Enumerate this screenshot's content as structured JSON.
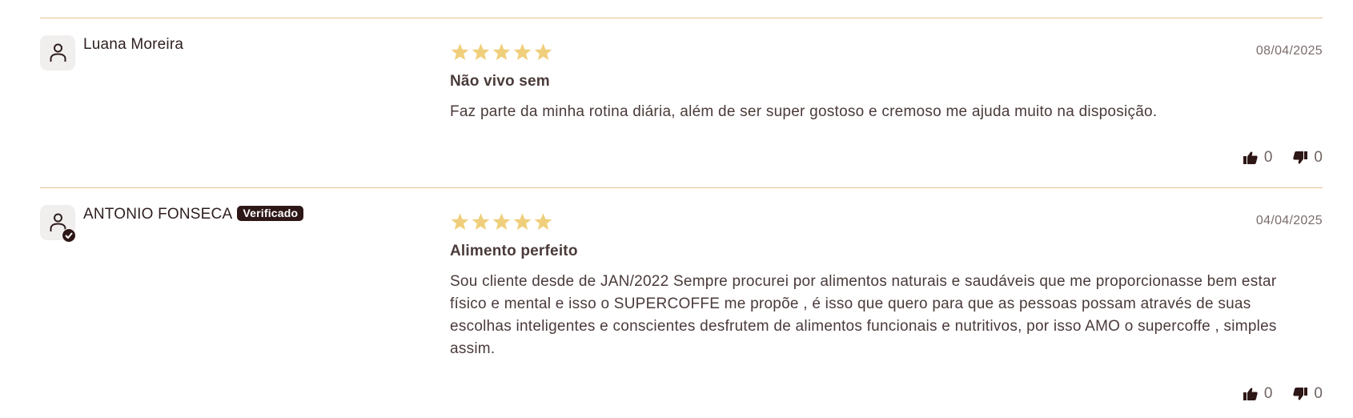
{
  "colors": {
    "divider": "#e8c08e",
    "star": "#f0cf7c",
    "badge_bg": "#2e1717",
    "text": "#4a3b3a",
    "muted": "#7a6d6b"
  },
  "reviews": [
    {
      "author": "Luana Moreira",
      "verified": false,
      "rating": 5,
      "date": "08/04/2025",
      "title": "Não vivo sem",
      "body": "Faz parte da minha rotina diária, além de ser super gostoso e cremoso me ajuda muito na disposição.",
      "likes": "0",
      "dislikes": "0",
      "avatar_icon": "user-icon",
      "like_icon": "thumbs-up-icon",
      "dislike_icon": "thumbs-down-icon"
    },
    {
      "author": "ANTONIO FONSECA",
      "verified": true,
      "badge_label": "Verificado",
      "rating": 5,
      "date": "04/04/2025",
      "title": "Alimento perfeito",
      "body": "Sou cliente desde de JAN/2022 Sempre procurei por alimentos naturais e saudáveis que me proporcionasse bem estar físico e mental e isso o SUPERCOFFE me propõe , é isso que quero para que as pessoas possam através de suas escolhas inteligentes e conscientes desfrutem de alimentos funcionais e nutritivos, por isso AMO o supercoffe , simples assim.",
      "likes": "0",
      "dislikes": "0",
      "avatar_icon": "verified-user-icon",
      "like_icon": "thumbs-up-icon",
      "dislike_icon": "thumbs-down-icon"
    }
  ]
}
